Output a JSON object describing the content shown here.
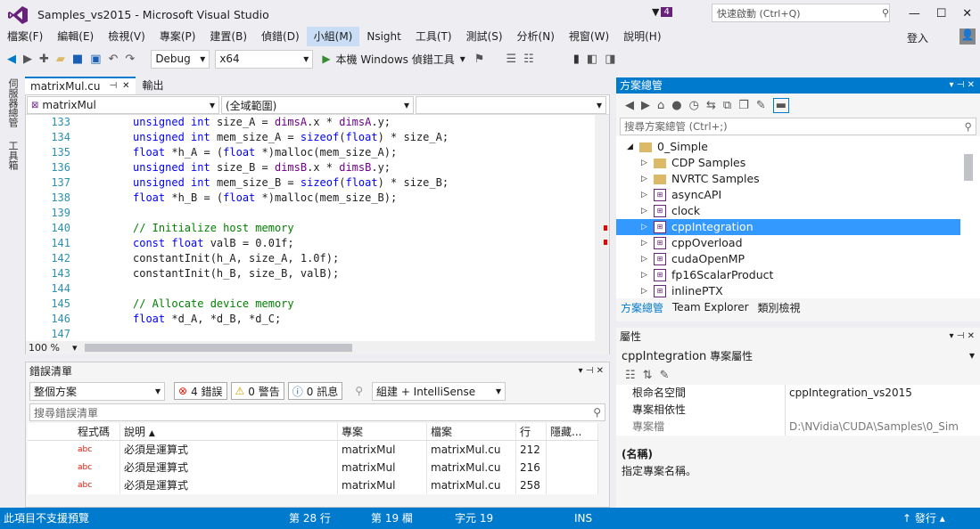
{
  "window": {
    "title": "Samples_vs2015 - Microsoft Visual Studio",
    "notifications_count": "4",
    "quick_launch_placeholder": "快速啟動 (Ctrl+Q)",
    "login": "登入"
  },
  "menu": [
    "檔案(F)",
    "編輯(E)",
    "檢視(V)",
    "專案(P)",
    "建置(B)",
    "偵錯(D)",
    "小組(M)",
    "Nsight",
    "工具(T)",
    "測試(S)",
    "分析(N)",
    "視窗(W)",
    "說明(H)"
  ],
  "toolbar": {
    "config": "Debug",
    "platform": "x64",
    "debug_target": "本機 Windows 偵錯工具"
  },
  "left_strip": {
    "server_explorer": "伺服器總管",
    "toolbox": "工具箱"
  },
  "doc_tabs": {
    "active": "matrixMul.cu",
    "other": "輸出"
  },
  "editor": {
    "nav_scope": "matrixMul",
    "nav_member": "(全域範圍)",
    "zoom": "100 %",
    "lines": [
      {
        "n": "133",
        "t": "unsigned int size_A = dimsA.x * dimsA.y;"
      },
      {
        "n": "134",
        "t": "unsigned int mem_size_A = sizeof(float) * size_A;"
      },
      {
        "n": "135",
        "t": "float *h_A = (float *)malloc(mem_size_A);"
      },
      {
        "n": "136",
        "t": "unsigned int size_B = dimsB.x * dimsB.y;"
      },
      {
        "n": "137",
        "t": "unsigned int mem_size_B = sizeof(float) * size_B;"
      },
      {
        "n": "138",
        "t": "float *h_B = (float *)malloc(mem_size_B);"
      },
      {
        "n": "139",
        "t": ""
      },
      {
        "n": "140",
        "t": "// Initialize host memory"
      },
      {
        "n": "141",
        "t": "const float valB = 0.01f;"
      },
      {
        "n": "142",
        "t": "constantInit(h_A, size_A, 1.0f);"
      },
      {
        "n": "143",
        "t": "constantInit(h_B, size_B, valB);"
      },
      {
        "n": "144",
        "t": ""
      },
      {
        "n": "145",
        "t": "// Allocate device memory"
      },
      {
        "n": "146",
        "t": "float *d_A, *d_B, *d_C;"
      },
      {
        "n": "147",
        "t": ""
      }
    ]
  },
  "error_list": {
    "title": "錯誤清單",
    "scope": "整個方案",
    "errors": "4 錯誤",
    "warnings": "0 警告",
    "messages": "0 訊息",
    "source": "組建 + IntelliSense",
    "search_placeholder": "搜尋錯誤清單",
    "columns": [
      "程式碼",
      "說明",
      "專案",
      "檔案",
      "行",
      "隱藏..."
    ],
    "rows": [
      {
        "code": "abc",
        "desc": "必須是運算式",
        "project": "matrixMul",
        "file": "matrixMul.cu",
        "line": "212"
      },
      {
        "code": "abc",
        "desc": "必須是運算式",
        "project": "matrixMul",
        "file": "matrixMul.cu",
        "line": "216"
      },
      {
        "code": "abc",
        "desc": "必須是運算式",
        "project": "matrixMul",
        "file": "matrixMul.cu",
        "line": "258"
      }
    ]
  },
  "solution_explorer": {
    "title": "方案總管",
    "search_placeholder": "搜尋方案總管 (Ctrl+;)",
    "items": [
      {
        "label": "0_Simple",
        "type": "folder",
        "expanded": true
      },
      {
        "label": "CDP Samples",
        "type": "folder"
      },
      {
        "label": "NVRTC Samples",
        "type": "folder"
      },
      {
        "label": "asyncAPI",
        "type": "project"
      },
      {
        "label": "clock",
        "type": "project"
      },
      {
        "label": "cppIntegration",
        "type": "project",
        "selected": true
      },
      {
        "label": "cppOverload",
        "type": "project"
      },
      {
        "label": "cudaOpenMP",
        "type": "project"
      },
      {
        "label": "fp16ScalarProduct",
        "type": "project"
      },
      {
        "label": "inlinePTX",
        "type": "project"
      }
    ],
    "tabs": [
      "方案總管",
      "Team Explorer",
      "類別檢視"
    ]
  },
  "properties": {
    "title": "屬性",
    "object": "cppIntegration",
    "object_type": "專案屬性",
    "rows": [
      {
        "name": "根命名空間",
        "value": "cppIntegration_vs2015"
      },
      {
        "name": "專案相依性",
        "value": ""
      },
      {
        "name": "專案檔",
        "value": "D:\\NVidia\\CUDA\\Samples\\0_Sim"
      }
    ],
    "desc_title": "(名稱)",
    "desc_text": "指定專案名稱。"
  },
  "status": {
    "message": "此項目不支援預覽",
    "line": "第 28 行",
    "col": "第 19 欄",
    "char": "字元 19",
    "mode": "INS",
    "publish": "發行"
  },
  "colors": {
    "accent": "#007acc",
    "vs_purple": "#68217a",
    "error": "#e51400"
  }
}
